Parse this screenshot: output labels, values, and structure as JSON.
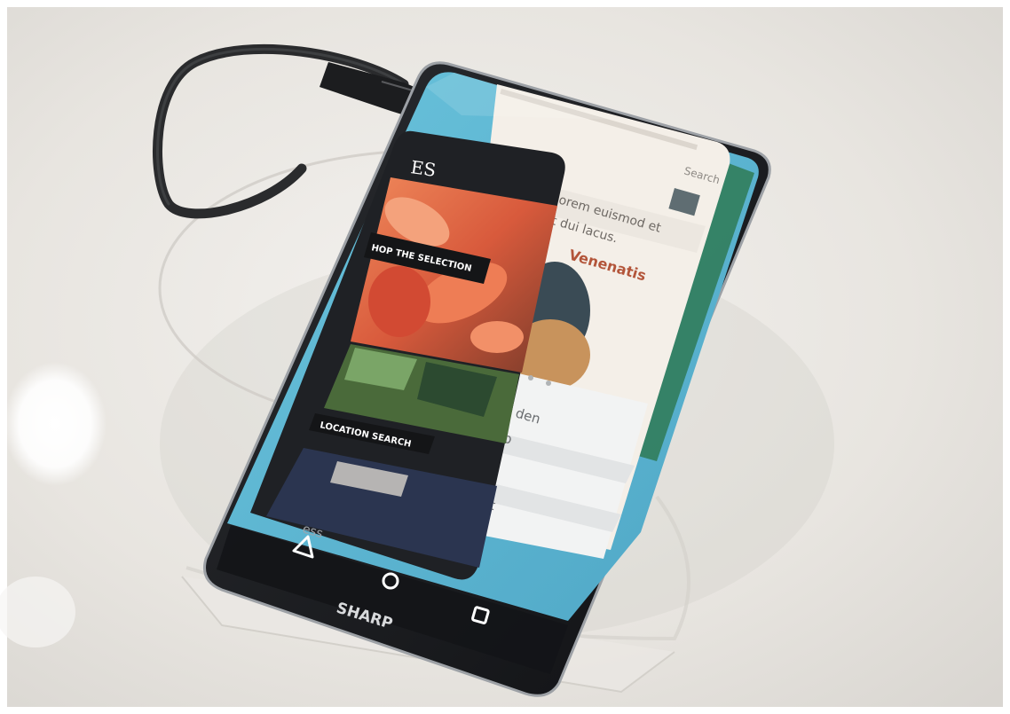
{
  "scene": {
    "background_color": "#e9e6e1",
    "device_color": "#1b1c1f",
    "screen_color": "#5fb7d2"
  },
  "phone": {
    "brand": "SHARP",
    "nav_buttons": [
      "back-icon",
      "home-icon",
      "recents-icon"
    ]
  },
  "cards": {
    "shop": {
      "header_partial": "ES",
      "shop_button": "HOP THE SELECTION",
      "location_button": "LOCATION SEARCH"
    },
    "blog": {
      "body_line_1": "lorem euismod et",
      "body_line_2": "ut dui lacus.",
      "heading_partial": "Venenatis",
      "search_placeholder": "Search"
    },
    "settings": {
      "row_1": "den",
      "row_2": "p",
      "row_3": "tt"
    },
    "footer_partial": "ess"
  }
}
